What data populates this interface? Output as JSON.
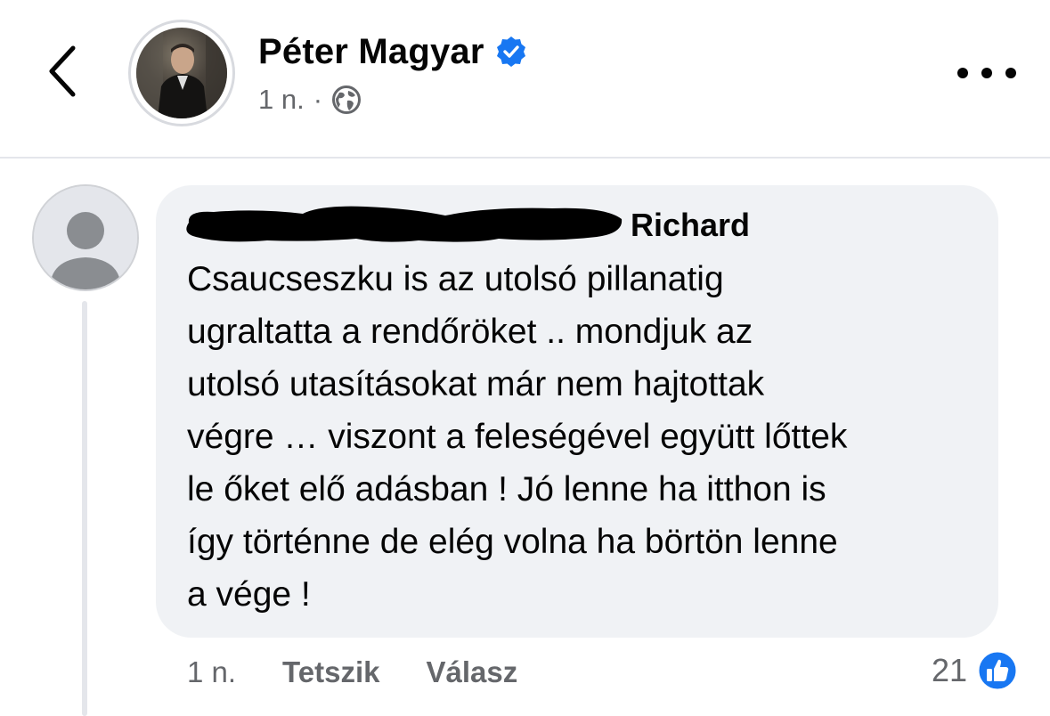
{
  "header": {
    "title": "Péter Magyar",
    "time": "1 n.",
    "separator": "·",
    "icons": {
      "back": "chevron-left-icon",
      "verified": "verified-badge-icon",
      "audience": "globe-icon",
      "more": "more-horizontal-icon"
    }
  },
  "comment": {
    "author": "Richard",
    "author_redacted": true,
    "text": "Csaucseszku is az utolsó pillanatig\nugraltatta a rendőröket ..  mondjuk az\nutolsó utasításokat már nem hajtottak\nvégre … viszont a feleségével együtt lőttek\nle őket elő adásban ! Jó lenne ha itthon is\nígy történne de elég volna ha börtön lenne\na vége !",
    "time": "1 n.",
    "like_label": "Tetszik",
    "reply_label": "Válasz",
    "reaction_count": "21",
    "reaction_icon": "like-reaction-icon"
  },
  "colors": {
    "accent": "#1877f2",
    "text_primary": "#050505",
    "text_secondary": "#65676b",
    "bubble_bg": "#f0f2f5",
    "divider": "#e4e6eb"
  }
}
